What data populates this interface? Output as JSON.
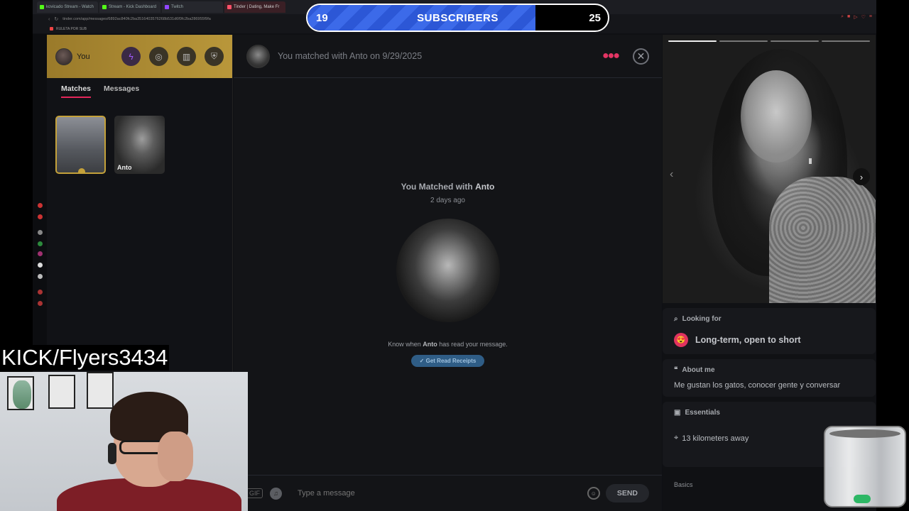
{
  "browser": {
    "tabs": [
      {
        "label": "kovicado Stream - Watch",
        "active": false
      },
      {
        "label": "Stream - Kick Dashboard",
        "active": false
      },
      {
        "label": "Twitch",
        "active": false
      },
      {
        "label": "Tinder | Dating, Make Fr",
        "active": true
      }
    ],
    "url": "tinder.com/app/messages/6892ac840fc2ba3516403576268b531d6f0fc2ba286955f9fa",
    "bookmark": "RULETA POR SUB"
  },
  "sidebar": {
    "user_label": "You",
    "tabs": [
      {
        "label": "Matches",
        "active": true
      },
      {
        "label": "Messages",
        "active": false
      }
    ],
    "match_cards": [
      {
        "name": ""
      },
      {
        "name": "Anto"
      }
    ]
  },
  "chat": {
    "header_text": "You matched with Anto on 9/29/2025",
    "matched_prefix": "You Matched with ",
    "matched_name": "Anto",
    "matched_ago": "2 days ago",
    "read_note_prefix": "Know when ",
    "read_note_name": "Anto",
    "read_note_suffix": " has read your message.",
    "receipts_button": "Get Read Receipts",
    "gif_label": "GIF",
    "input_placeholder": "Type a message",
    "send_label": "SEND"
  },
  "profile": {
    "photo_count": 4,
    "photo_active": 1,
    "looking_for_title": "Looking for",
    "looking_for_emoji": "😍",
    "looking_for_value": "Long-term, open to short",
    "about_title": "About me",
    "about_text": "Me gustan los gatos, conocer gente y conversar",
    "essentials_title": "Essentials",
    "distance": "13 kilometers away",
    "basics_title": "Basics"
  },
  "overlay": {
    "sub_current": "19",
    "sub_title": "SUBSCRIBERS",
    "sub_goal": "25",
    "sub_progress": 0.76,
    "kick_tag": "KICK/Flyers3434"
  },
  "colors": {
    "tinder_accent": "#e3265a",
    "gold": "#c4a13a",
    "sub_bar_blue": "#2c57d6"
  }
}
